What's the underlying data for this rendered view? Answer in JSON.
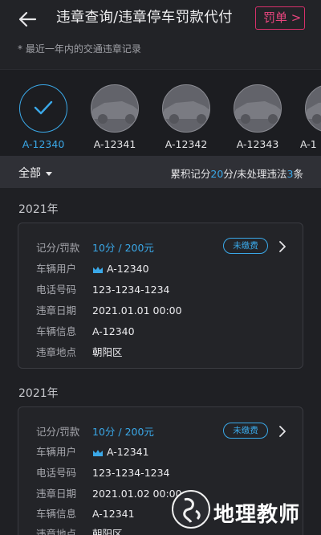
{
  "header": {
    "title": "违章查询/违章停车罚款代付",
    "ticket_button": "罚单 >",
    "subtitle": "* 最近一年内的交通违章记录"
  },
  "vehicles": [
    {
      "plate": "A-12340",
      "selected": true
    },
    {
      "plate": "A-12341",
      "selected": false
    },
    {
      "plate": "A-12342",
      "selected": false
    },
    {
      "plate": "A-12343",
      "selected": false
    },
    {
      "plate": "A-1",
      "selected": false
    }
  ],
  "filter": {
    "label": "全部",
    "summary_prefix": "累积记分",
    "points": "20",
    "summary_mid": "分/未处理违法",
    "count": "3",
    "summary_suffix": "条"
  },
  "records": [
    {
      "year": "2021年",
      "status": "未缴费",
      "rows": [
        {
          "key": "记分/罚款",
          "value": "10分 / 200元"
        },
        {
          "key": "车辆用户",
          "value": "A-12340"
        },
        {
          "key": "电话号码",
          "value": "123-1234-1234"
        },
        {
          "key": "违章日期",
          "value": "2021.01.01 00:00"
        },
        {
          "key": "车辆信息",
          "value": "A-12340"
        },
        {
          "key": "违章地点",
          "value": "朝阳区"
        }
      ]
    },
    {
      "year": "2021年",
      "status": "未缴费",
      "rows": [
        {
          "key": "记分/罚款",
          "value": "10分 / 200元"
        },
        {
          "key": "车辆用户",
          "value": "A-12341"
        },
        {
          "key": "电话号码",
          "value": "123-1234-1234"
        },
        {
          "key": "违章日期",
          "value": "2021.01.02 00:00"
        },
        {
          "key": "车辆信息",
          "value": "A-12341"
        },
        {
          "key": "违章地点",
          "value": "朝阳区"
        }
      ]
    }
  ],
  "watermark": {
    "text": "地理教师"
  },
  "colors": {
    "accent": "#3aa8e8",
    "brand_pink": "#e8457e",
    "background": "#1f2024"
  }
}
